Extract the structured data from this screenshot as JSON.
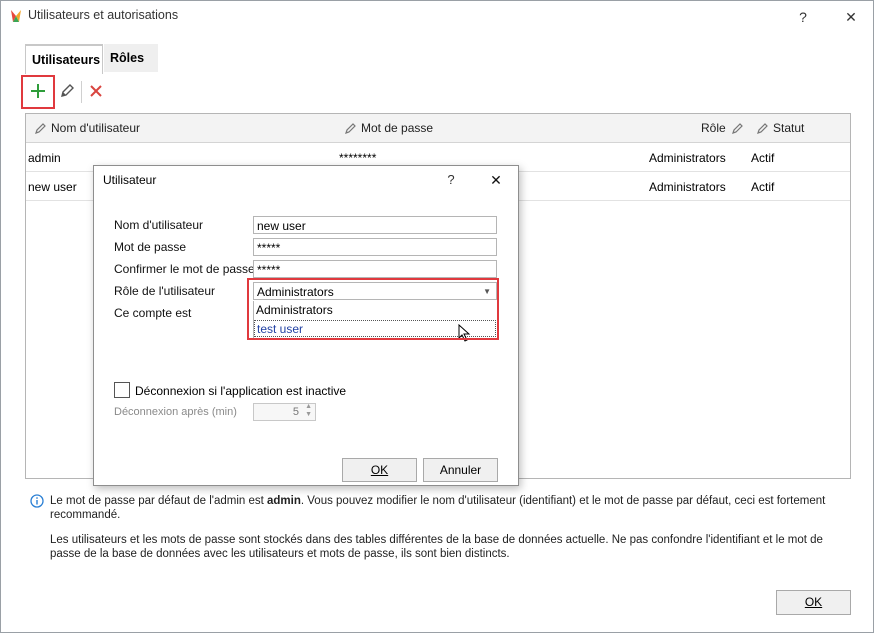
{
  "window": {
    "title": "Utilisateurs et autorisations",
    "help": "?",
    "close": "✕"
  },
  "tabs": [
    {
      "label": "Utilisateurs"
    },
    {
      "label": "Rôles"
    }
  ],
  "toolbar": {
    "add": "add-icon",
    "edit": "edit-icon",
    "delete": "delete-icon"
  },
  "grid": {
    "columns": [
      "Nom d'utilisateur",
      "Mot de passe",
      "Rôle",
      "Statut"
    ],
    "rows": [
      {
        "username": "admin",
        "password": "********",
        "role": "Administrators",
        "status": "Actif"
      },
      {
        "username": "new user",
        "password": "",
        "role": "Administrators",
        "status": "Actif"
      }
    ]
  },
  "info": {
    "p1_before": "Le mot de passe par défaut de l'admin est ",
    "p1_bold": "admin",
    "p1_after": ". Vous pouvez modifier le nom d'utilisateur (identifiant) et le mot de passe par défaut, ceci est fortement recommandé.",
    "p2": "Les utilisateurs et les mots de passe sont stockés dans des tables différentes de la base de données actuelle. Ne pas confondre l'identifiant et le mot de passe de la base de données avec les utilisateurs et mots de passe, ils sont bien distincts."
  },
  "footer": {
    "ok": "OK"
  },
  "dialog": {
    "title": "Utilisateur",
    "help": "?",
    "close": "✕",
    "labels": {
      "username": "Nom d'utilisateur",
      "password": "Mot de passe",
      "confirm": "Confirmer le mot de passe",
      "role": "Rôle de l'utilisateur",
      "account": "Ce compte est"
    },
    "values": {
      "username": "new user",
      "password": "*****",
      "confirm": "*****",
      "role": "Administrators"
    },
    "role_options": [
      "Administrators",
      "test user"
    ],
    "logout_checkbox": "Déconnexion si l'application est inactive",
    "logout_after_label": "Déconnexion après (min)",
    "logout_after_value": "5",
    "ok": "OK",
    "cancel": "Annuler"
  }
}
